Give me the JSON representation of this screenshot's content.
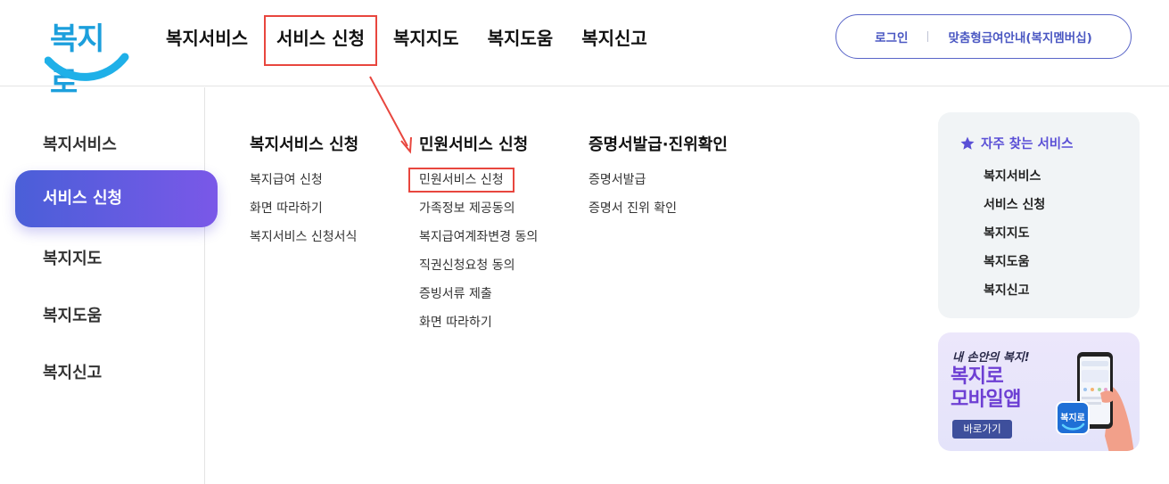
{
  "header": {
    "logo_text": "복지로",
    "nav": [
      {
        "label": "복지서비스"
      },
      {
        "label": "서비스 신청"
      },
      {
        "label": "복지지도"
      },
      {
        "label": "복지도움"
      },
      {
        "label": "복지신고"
      }
    ],
    "util": {
      "login": "로그인",
      "membership": "맞춤형급여안내(복지멤버십)"
    }
  },
  "side_menu": {
    "items": [
      {
        "label": "복지서비스"
      },
      {
        "label": "서비스 신청"
      },
      {
        "label": "복지지도"
      },
      {
        "label": "복지도움"
      },
      {
        "label": "복지신고"
      }
    ]
  },
  "mega_menu": {
    "columns": [
      {
        "title": "복지서비스 신청",
        "items": [
          "복지급여 신청",
          "화면 따라하기",
          "복지서비스 신청서식"
        ]
      },
      {
        "title": "민원서비스 신청",
        "items": [
          "민원서비스 신청",
          "가족정보 제공동의",
          "복지급여계좌변경 동의",
          "직권신청요청 동의",
          "증빙서류 제출",
          "화면 따라하기"
        ]
      },
      {
        "title": "증명서발급·진위확인",
        "items": [
          "증명서발급",
          "증명서 진위 확인"
        ]
      }
    ]
  },
  "favorites": {
    "title": "자주 찾는 서비스",
    "items": [
      "복지서비스",
      "서비스 신청",
      "복지지도",
      "복지도움",
      "복지신고"
    ]
  },
  "banner": {
    "subtitle": "내 손안의 복지!",
    "title": "복지로\n모바일앱",
    "button": "바로가기",
    "app_icon_text": "복지로"
  },
  "colors": {
    "accent": "#5a4fd6",
    "annotation": "#e8463e",
    "logo": "#1c9fdc"
  }
}
